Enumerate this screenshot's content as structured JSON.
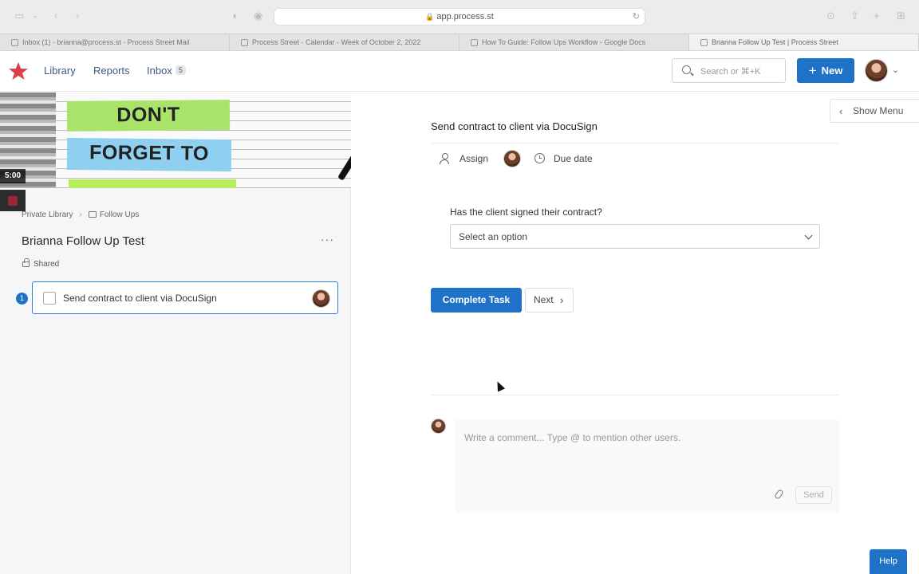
{
  "browser": {
    "url": "app.process.st",
    "tabs": [
      {
        "title": "Inbox (1) - brianna@process.st - Process Street Mail"
      },
      {
        "title": "Process Street - Calendar - Week of October 2, 2022"
      },
      {
        "title": "How To Guide: Follow Ups Workflow - Google Docs"
      },
      {
        "title": "Brianna Follow Up Test | Process Street"
      }
    ]
  },
  "header": {
    "nav": {
      "library": "Library",
      "reports": "Reports",
      "inbox": "Inbox"
    },
    "inbox_count": "5",
    "search_placeholder": "Search or ⌘+K",
    "new_button": "New",
    "colors": {
      "brand_red": "#d9414a",
      "accent_blue": "#1e72c8"
    }
  },
  "video": {
    "note_lines": [
      "DON'T",
      "FORGET TO"
    ],
    "time": "5:00"
  },
  "sidebar": {
    "breadcrumb": [
      "Private Library",
      "Follow Ups"
    ],
    "workflow_title": "Brianna Follow Up Test",
    "shared_label": "Shared",
    "tasks": [
      {
        "number": "1",
        "label": "Send contract to client via DocuSign"
      }
    ]
  },
  "main": {
    "show_menu": "Show Menu",
    "task_title": "Send contract to client via DocuSign",
    "assign_label": "Assign",
    "due_date_label": "Due date",
    "question": "Has the client signed their contract?",
    "select_value": "Select an option",
    "complete_button": "Complete Task",
    "next_button": "Next",
    "comment_placeholder": "Write a comment... Type @ to mention other users.",
    "send_button": "Send"
  },
  "help_button": "Help"
}
